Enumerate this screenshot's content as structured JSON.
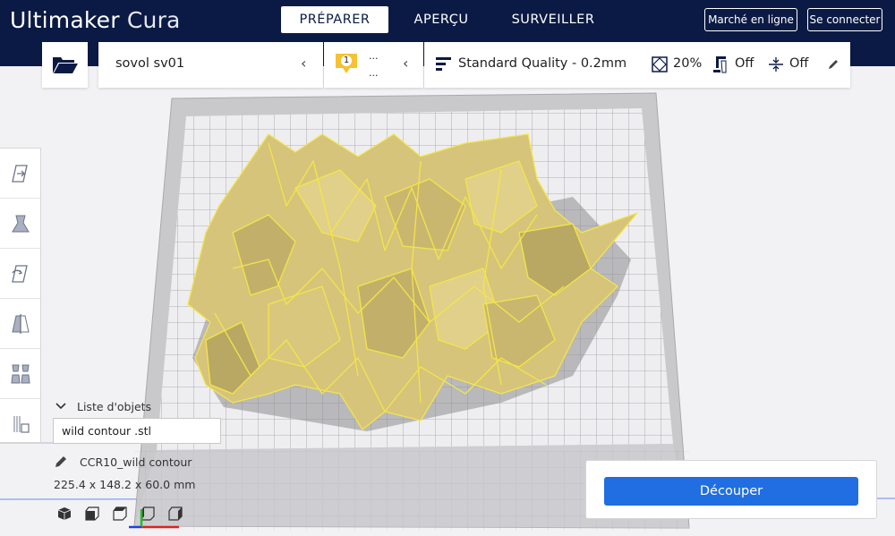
{
  "app": {
    "brand_bold": "Ultimaker",
    "brand_thin": "Cura"
  },
  "header": {
    "tabs": [
      {
        "label": "PRÉPARER",
        "active": true
      },
      {
        "label": "APERÇU",
        "active": false
      },
      {
        "label": "SURVEILLER",
        "active": false
      }
    ],
    "marketplace_label": "Marché en ligne",
    "signin_label": "Se connecter"
  },
  "printer": {
    "name": "sovol sv01"
  },
  "extruder": {
    "badge": "1",
    "top": "...",
    "bottom": "..."
  },
  "print_settings": {
    "profile": "Standard Quality - 0.2mm",
    "infill": "20%",
    "support": "Off",
    "adhesion": "Off"
  },
  "object_list": {
    "header": "Liste d'objets",
    "item": "wild contour .stl"
  },
  "model_info": {
    "name": "CCR10_wild contour",
    "dimensions": "225.4 x 148.2 x 60.0 mm"
  },
  "slice": {
    "button_label": "Découper"
  },
  "colors": {
    "header_bg": "#0b1a44",
    "slice_blue": "#206ee2",
    "model_fill": "#d9c77e",
    "model_outline": "#f5e84a"
  }
}
